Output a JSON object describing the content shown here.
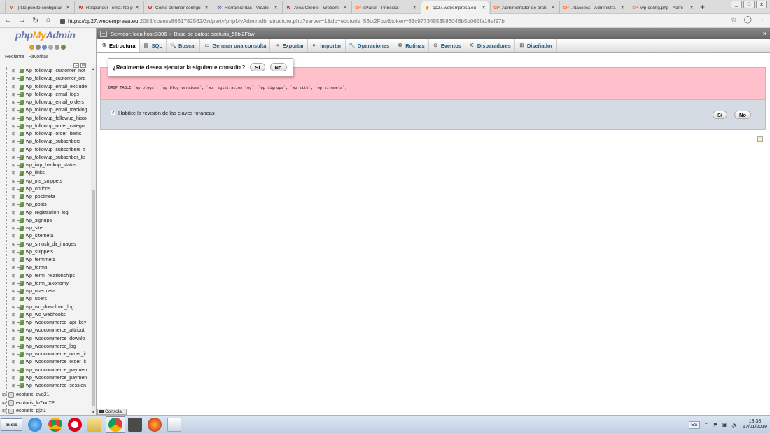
{
  "browser": {
    "tabs": [
      {
        "label": "[] No puedo configurar",
        "icon": "gmail-icon",
        "active": false
      },
      {
        "label": "Responder Tema: No p",
        "icon": "webempresa-icon",
        "active": false
      },
      {
        "label": "Cómo eliminar configu",
        "icon": "webempresa-icon",
        "active": false
      },
      {
        "label": "Herramientas - Vidalo",
        "icon": "tools-icon",
        "active": false
      },
      {
        "label": "Área Cliente - Webem",
        "icon": "webempresa-icon",
        "active": false
      },
      {
        "label": "cPanel - Principal",
        "icon": "cpanel-icon",
        "active": false
      },
      {
        "label": "cp27.webempresa.eu",
        "icon": "phpmyadmin-icon",
        "active": true
      },
      {
        "label": "Administrador de arch",
        "icon": "cpanel-icon",
        "active": false
      },
      {
        "label": ".htaccess - Administra",
        "icon": "cpanel-icon",
        "active": false
      },
      {
        "label": "wp-config.php - Admi",
        "icon": "cpanel-icon",
        "active": false
      }
    ],
    "url_main": "https://cp27.webempresa.eu",
    "url_rest": ":2083/cpsess8661782562/3rdparty/phpMyAdmin/db_structure.php?server=1&db=ecoturis_56tx2Fbw&token=63c97734853586046b5b065fa16ef97b"
  },
  "pma": {
    "logo_php": "php",
    "logo_my": "My",
    "logo_admin": "Admin",
    "recent_label": "Reciente",
    "favorites_label": "Favoritas",
    "tables": [
      "wp_followup_customer_not",
      "wp_followup_customer_ord",
      "wp_followup_email_exclude",
      "wp_followup_email_logs",
      "wp_followup_email_orders",
      "wp_followup_email_tracking",
      "wp_followup_followup_histo",
      "wp_followup_order_categor",
      "wp_followup_order_items",
      "wp_followup_subscribers",
      "wp_followup_subscribers_t",
      "wp_followup_subscriber_lis",
      "wp_iwp_backup_status",
      "wp_links",
      "wp_ms_snippets",
      "wp_options",
      "wp_postmeta",
      "wp_posts",
      "wp_registration_log",
      "wp_signups",
      "wp_site",
      "wp_sitemeta",
      "wp_smush_dir_images",
      "wp_snippets",
      "wp_termmeta",
      "wp_terms",
      "wp_term_relationships",
      "wp_term_taxonomy",
      "wp_usermeta",
      "wp_users",
      "wp_wc_download_log",
      "wp_wc_webhooks",
      "wp_woocommerce_api_key",
      "wp_woocommerce_attribut",
      "wp_woocommerce_downlo",
      "wp_woocommerce_log",
      "wp_woocommerce_order_it",
      "wp_woocommerce_order_it",
      "wp_woocommerce_paymen",
      "wp_woocommerce_paymen",
      "wp_woocommerce_session"
    ],
    "databases": [
      "ecoturis_dvq21",
      "ecoturis_ln7xxi7P",
      "ecoturis_pjzi1"
    ],
    "breadcrumb_server": "Servidor: localhost:3306",
    "breadcrumb_sep": "»",
    "breadcrumb_db": "Base de datos: ecoturis_56tx2Fbw",
    "menu": [
      {
        "label": "Estructura",
        "icon": "structure-icon",
        "active": true
      },
      {
        "label": "SQL",
        "icon": "sql-icon",
        "active": false
      },
      {
        "label": "Buscar",
        "icon": "search-icon",
        "active": false
      },
      {
        "label": "Generar una consulta",
        "icon": "query-icon",
        "active": false
      },
      {
        "label": "Exportar",
        "icon": "export-icon",
        "active": false
      },
      {
        "label": "Importar",
        "icon": "import-icon",
        "active": false
      },
      {
        "label": "Operaciones",
        "icon": "wrench-icon",
        "active": false
      },
      {
        "label": "Rutinas",
        "icon": "routines-icon",
        "active": false
      },
      {
        "label": "Eventos",
        "icon": "clock-icon",
        "active": false
      },
      {
        "label": "Disparadores",
        "icon": "triggers-icon",
        "active": false
      },
      {
        "label": "Diseñador",
        "icon": "designer-icon",
        "active": false
      }
    ],
    "confirm_question": "¿Realmente desea ejecutar la siguiente consulta?",
    "yes": "Sí",
    "no": "No",
    "sql_query": "DROP TABLE `wp_blogs`, `wp_blog_versions`, `wp_registration_log`, `wp_signups`, `wp_site`, `wp_sitemeta`;",
    "fk_label": "Habilite la revisión de las claves foráneas",
    "console_label": "Consola"
  },
  "taskbar": {
    "start_label": "Inicio",
    "lang": "ES",
    "time": "13:38",
    "date": "17/01/2019"
  },
  "colors": {
    "query_bg": "#ffc0cb",
    "fk_bg": "#d5dbe3",
    "menu_text": "#235a81"
  }
}
